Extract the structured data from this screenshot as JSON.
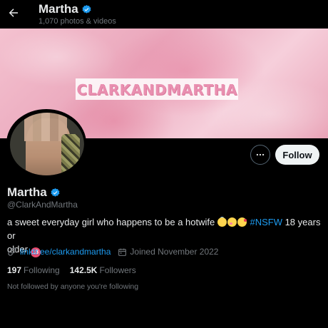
{
  "header": {
    "title": "Martha",
    "subtitle": "1,070 photos & videos",
    "back_icon": "arrow-left-icon"
  },
  "banner": {
    "text": "CLARKANDMARTHA"
  },
  "actions": {
    "more_icon": "ellipsis-icon",
    "follow_label": "Follow"
  },
  "profile": {
    "name": "Martha",
    "handle": "@ClarkAndMartha",
    "verified": true,
    "bio_line1": "a sweet everyday girl who happens to be a hotwife ",
    "bio_hashtag": "#NSFW",
    "bio_line2": " 18 years or",
    "bio_line3": "older ",
    "bio_badge": "18",
    "website": "linktr.ee/clarkandmartha",
    "joined": "Joined November 2022",
    "following_count": "197",
    "following_label": "Following",
    "followers_count": "142.5K",
    "followers_label": "Followers",
    "not_followed": "Not followed by anyone you're following"
  },
  "colors": {
    "accent": "#1d9bf0",
    "background": "#000000",
    "text": "#e7e9ea",
    "muted": "#71767b"
  }
}
